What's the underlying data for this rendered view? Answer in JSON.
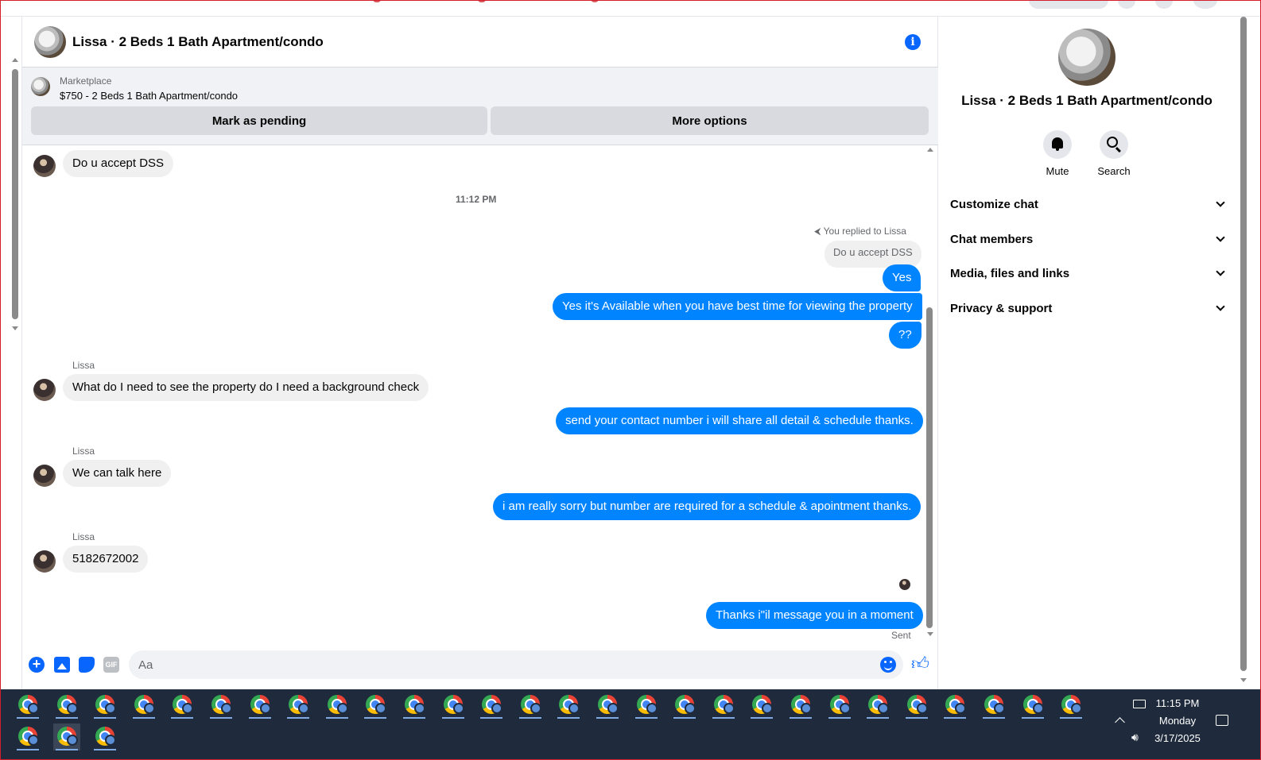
{
  "chat": {
    "title": "Lissa · 2 Beds 1 Bath Apartment/condo",
    "listing": {
      "label": "Marketplace",
      "price_title": "$750 - 2 Beds 1 Bath Apartment/condo",
      "mark_pending": "Mark as pending",
      "more_options": "More options"
    },
    "messages": {
      "m1": "Do u accept DSS",
      "time1": "11:12 PM",
      "reply_note": "You replied to Lissa",
      "reply_quote": "Do u accept DSS",
      "m2": "Yes",
      "m3": "Yes it's Available when you have best time for viewing the property",
      "m4": "??",
      "sender": "Lissa",
      "m5": "What do I need to see the property do I need a background check",
      "m6": "send your contact number i will share all detail & schedule thanks.",
      "m7": "We can talk here",
      "m8": "i am really sorry but number are required for a schedule & apointment thanks.",
      "m9": "5182672002",
      "m10": "Thanks i\"il message you in a moment",
      "status": "Sent"
    },
    "composer": {
      "placeholder": "Aa",
      "gif": "GIF"
    }
  },
  "side": {
    "title": "Lissa · 2 Beds 1 Bath Apartment/condo",
    "mute": "Mute",
    "search": "Search",
    "rows": [
      "Customize chat",
      "Chat members",
      "Media, files and links",
      "Privacy & support"
    ]
  },
  "taskbar": {
    "time": "11:15 PM",
    "day": "Monday",
    "date": "3/17/2025"
  },
  "colors": {
    "accent": "#0866ff",
    "outgoing_bubble": "#0084ff",
    "incoming_bubble": "#f0f0f0",
    "taskbar": "#1f2b3d"
  },
  "icons": [
    "info-icon",
    "plus-icon",
    "photo-icon",
    "sticker-icon",
    "gif-icon",
    "emoji-icon",
    "like-icon",
    "bell-icon",
    "search-icon",
    "chevron-down-icon",
    "reply-arrow-icon",
    "chrome-icon"
  ]
}
